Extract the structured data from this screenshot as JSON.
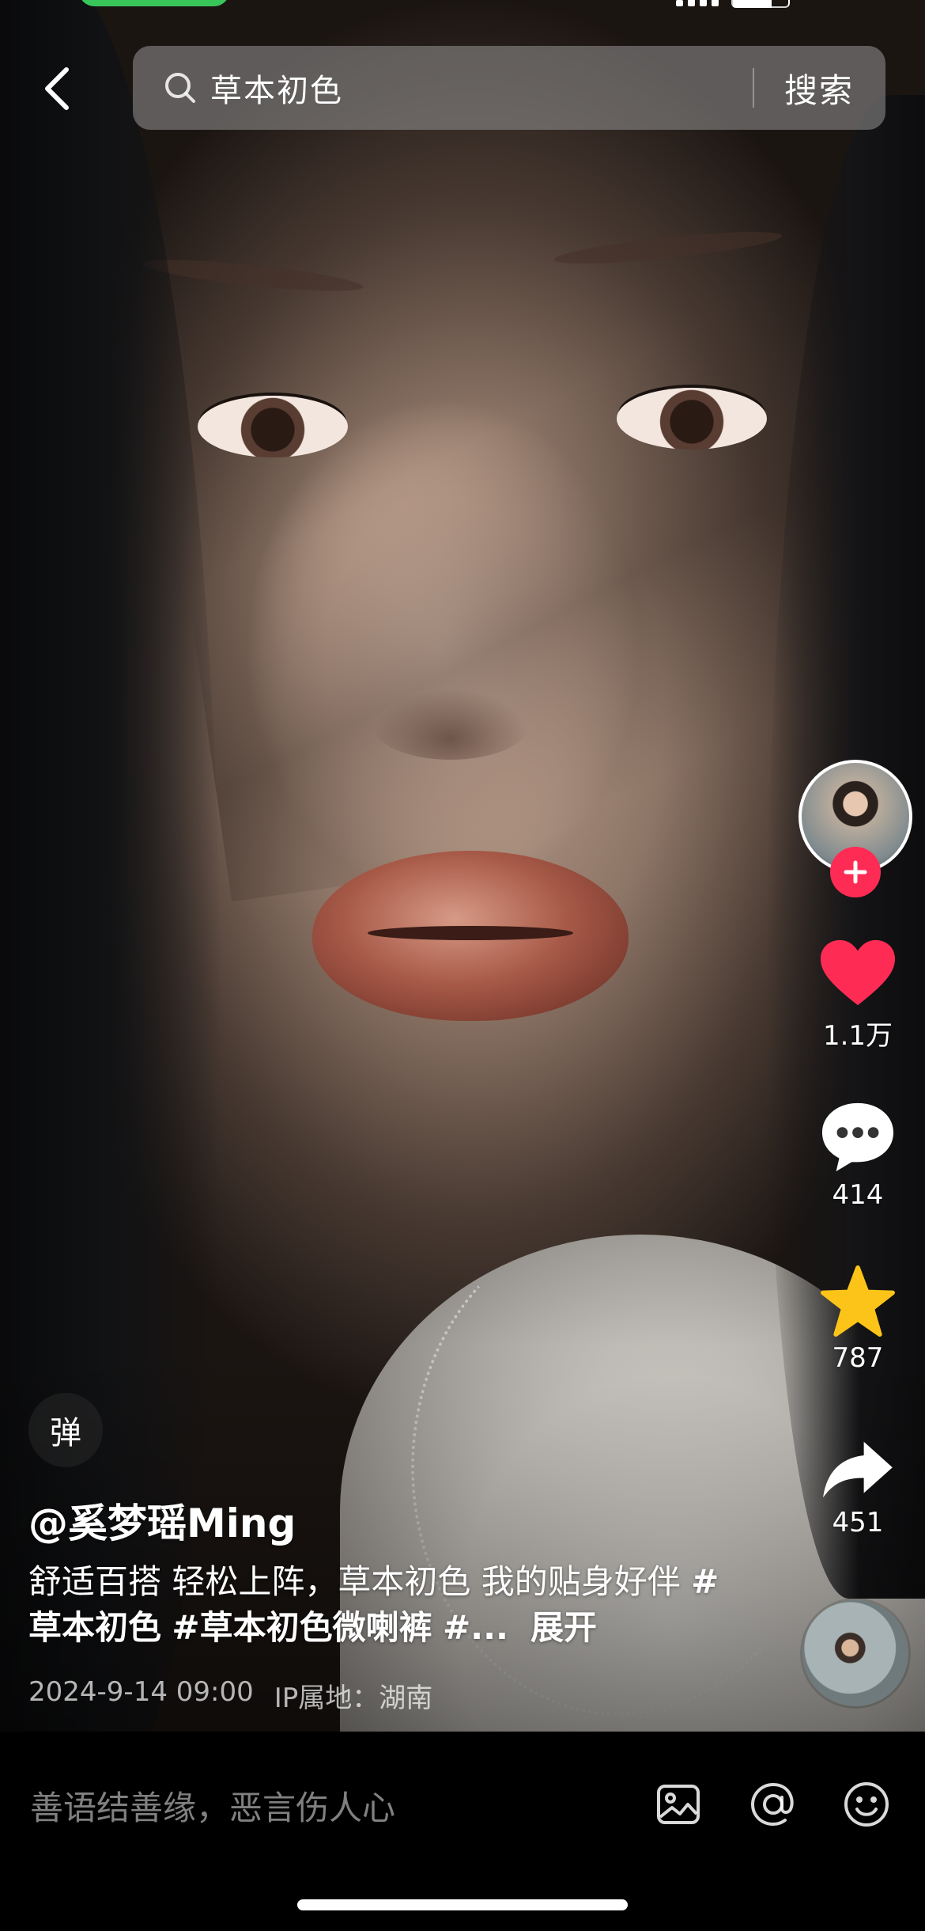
{
  "search": {
    "query": "草本初色",
    "button_label": "搜索"
  },
  "author": {
    "handle": "@奚梦瑶Ming"
  },
  "caption": {
    "text_before": "舒适百搭 轻松上阵，草本初色 我的贴身好伴 ",
    "tags": [
      "#草本初色",
      "#草本初色微喇裤",
      "#..."
    ],
    "expand_label": "展开"
  },
  "meta": {
    "datetime": "2024-9-14 09:00",
    "ip_location": "IP属地：湖南"
  },
  "danmaku": {
    "label": "弹"
  },
  "actions": {
    "likes": "1.1万",
    "comments": "414",
    "favorites": "787",
    "shares": "451"
  },
  "comment_bar": {
    "placeholder": "善语结善缘，恶言伤人心"
  },
  "colors": {
    "like_red": "#fe2c55",
    "favorite_yellow": "#fcc419",
    "status_green": "#38c65a"
  },
  "icons": {
    "back": "chevron-left-icon",
    "search": "search-icon",
    "follow": "plus-icon",
    "like": "heart-icon",
    "comment": "chat-bubble-icon",
    "favorite": "star-icon",
    "share": "share-arrow-icon",
    "image": "image-icon",
    "mention": "at-icon",
    "emoji": "emoji-icon"
  }
}
